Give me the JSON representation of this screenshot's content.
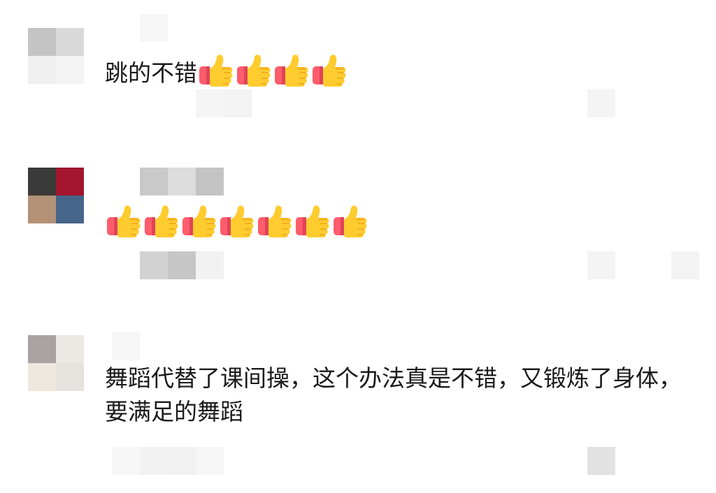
{
  "comments": [
    {
      "avatar_colors": [
        "#c4c4c4",
        "#d9d9d9",
        "#f0f0f0",
        "#f3f3f3"
      ],
      "text": "跳的不错",
      "thumbs_count": 4,
      "name_blur": [
        "#f7f7f7"
      ],
      "footer_blur": [
        "#f5f5f5",
        "#f3f3f3",
        "#f4f4f4"
      ]
    },
    {
      "avatar_colors": [
        "#3a3a3a",
        "#a3152c",
        "#b39277",
        "#46658a"
      ],
      "text": "",
      "thumbs_count": 7,
      "name_blur": [
        "#c9c9c9",
        "#dcdcdc",
        "#c4c4c4"
      ],
      "footer_blur": [
        "#d2d2d2",
        "#c6c6c6",
        "#f2f2f2",
        "#f4f4f4",
        "#f3f3f3"
      ]
    },
    {
      "avatar_colors": [
        "#a9a3a3",
        "#ece8e3",
        "#efe8df",
        "#e6e2de"
      ],
      "text": "舞蹈代替了课间操，这个办法真是不错，又锻炼了身体，要满足的舞蹈",
      "thumbs_count": 0,
      "name_blur": [
        "#f6f6f6"
      ],
      "footer_blur": [
        "#f7f7f7",
        "#f2f2f2",
        "#f1f1f1",
        "#f6f6f6",
        "#e2e2e2"
      ]
    }
  ],
  "icon": "thumbs-up-icon",
  "colors": {
    "thumb_skin": "#ffcc2f",
    "thumb_shade": "#f0a316",
    "cuff": "#ff5c6c",
    "cuff_shade": "#e0435a"
  }
}
